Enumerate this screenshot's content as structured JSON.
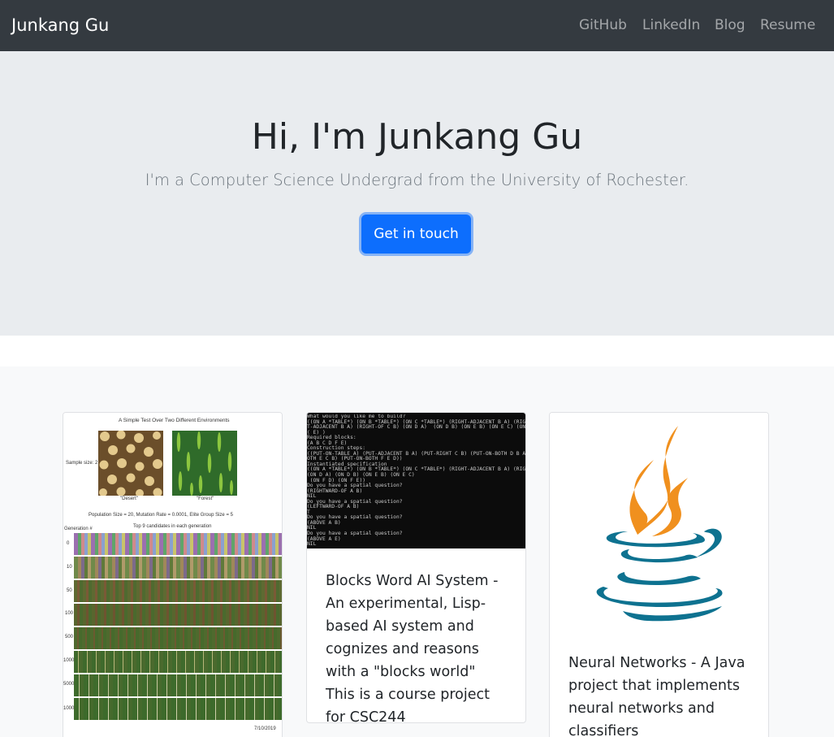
{
  "navbar": {
    "brand": "Junkang Gu",
    "links": [
      "GitHub",
      "LinkedIn",
      "Blog",
      "Resume"
    ]
  },
  "hero": {
    "title": "Hi, I'm Junkang Gu",
    "lead": "I'm a Computer Science Undergrad from the University of Rochester.",
    "button": "Get in touch"
  },
  "projects": [
    {
      "image": {
        "title": "A Simple Test Over Two Different Environments",
        "sample_label": "Sample size: 2",
        "env_labels": [
          "\"Desert\"",
          "\"Forest\""
        ],
        "params": "Population Size = 20, Mutation Rate = 0.0001, Elite Group Size = 5",
        "subtitle": "Top 9 candidates in each generation",
        "generation_header": "Generation #",
        "generations": [
          "0",
          "10",
          "50",
          "100",
          "500",
          "1000",
          "5000",
          "10000"
        ],
        "date": "7/10/2019"
      },
      "description": ""
    },
    {
      "terminal_text": "What would you like me to build?\n((ON A *TABLE*) (ON B *TABLE*) (ON C *TABLE*) (RIGHT-ADJACENT B A) (RIGHTMOST\nT-ADJACENT B A) (RIGHT-OF C B) (ON D A)  (ON D B) (ON E B) (ON E C) (ON F D)  (ON F\n( E) )\nRequired blocks:\n(A B C D F E)\nConstruction steps:\n((PUT-ON-TABLE A) (PUT-ADJACENT B A) (PUT-RIGHT C B) (PUT-ON-BOTH D B A) (PUT-ON-\nOTH E C B) (PUT-ON-BOTH F E D))\nInstantiated specification\n((ON A *TABLE*) (ON B *TABLE*) (ON C *TABLE*) (RIGHT-ADJACENT B A) (RIGHT-OF C B)\n(ON D A) (ON D B) (ON E B) (ON E C)\n (ON F D) (ON F E))\nDo you have a spatial question?\n(RIGHTWARD-OF A B)\nNIL\nDo you have a spatial question?\n(LEFTWARD-OF A B)\nT\nDo you have a spatial question?\n(ABOVE A B)\nNIL\nDo you have a spatial question?\n(ABOVE A E)\nNIL",
      "description": "Blocks Word AI System - An experimental, Lisp-based AI system and cognizes and reasons with a \"blocks world\" This is a course project for CSC244"
    },
    {
      "icon": "java-logo-icon",
      "description": "Neural Networks - A Java project that implements neural networks and classifiers"
    }
  ],
  "colors": {
    "navbar": "#343a40",
    "jumbotron": "#e9ecef",
    "primary": "#0d6efd",
    "java_orange": "#f0901e",
    "java_blue": "#0e7290"
  }
}
